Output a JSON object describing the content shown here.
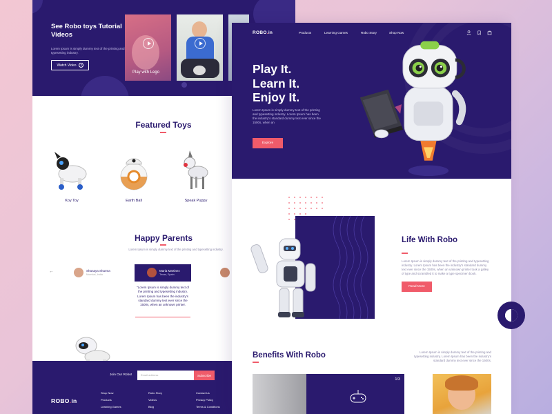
{
  "left": {
    "hero": {
      "title": "See Robo toys Tutorial Videos",
      "text": "Lorem Ipsum is simply dummy text of the printing and typesetting industry.",
      "watch_label": "Watch Video",
      "video_caption": "Play with Lego"
    },
    "featured": {
      "title": "Featured Toys",
      "toys": [
        "Koy Toy",
        "Earth Ball",
        "Speak Puppy"
      ]
    },
    "parents": {
      "title": "Happy Parents",
      "subtitle": "Lorem Ipsum is simply dummy text of the printing and typesetting industry.",
      "cards": [
        {
          "name": "Shanaya Sharma",
          "role": "Mumbai, India"
        },
        {
          "name": "Maria Martinez",
          "role": "Texas, Spain"
        }
      ],
      "quote": "\"Lorem Ipsum is simply dummy text of the printing and typesetting industry. Lorem Ipsum has been the industry's standard dummy text ever since the 1500s, when an unknown printer."
    },
    "footer": {
      "join_label": "Join Our Robo!",
      "email_placeholder": "Email address",
      "subscribe_label": "Subscribe",
      "logo": "ROBO.in",
      "col1": [
        "Shop Now",
        "Products",
        "Learning Games"
      ],
      "col2": [
        "Robo Story",
        "Videos",
        "Blog"
      ],
      "col3": [
        "Contact Us",
        "Privacy Policy",
        "Terms & Conditions"
      ]
    }
  },
  "right": {
    "logo": "ROBO.in",
    "nav": [
      "Products",
      "Learning Games",
      "Robo Story",
      "Shop Now"
    ],
    "hero": {
      "headline": [
        "Play It.",
        "Learn It.",
        "Enjoy It."
      ],
      "text": "Lorem Ipsum is simply dummy text of the printing and typesetting industry. Lorem Ipsum has been the industry's standard dummy text ever since the 1500s, when an",
      "cta": "Explore"
    },
    "life": {
      "title": "Life With Robo",
      "text": "Lorem Ipsum is simply dummy text of the printing and typesetting industry. Lorem Ipsum has been the industry's standard dummy text ever since the 1500s, when an unknown printer took a galley of type and scrambled it to make a type specimen book.",
      "cta": "Read More"
    },
    "benefits": {
      "title": "Benefits With Robo",
      "text": "Lorem Ipsum is simply dummy text of the printing and typesetting industry. Lorem Ipsum has been the industry's standard dummy text ever since the 1500s.",
      "pager": "1/3"
    }
  },
  "colors": {
    "navy": "#2a1a6e",
    "coral": "#f05b6a"
  }
}
